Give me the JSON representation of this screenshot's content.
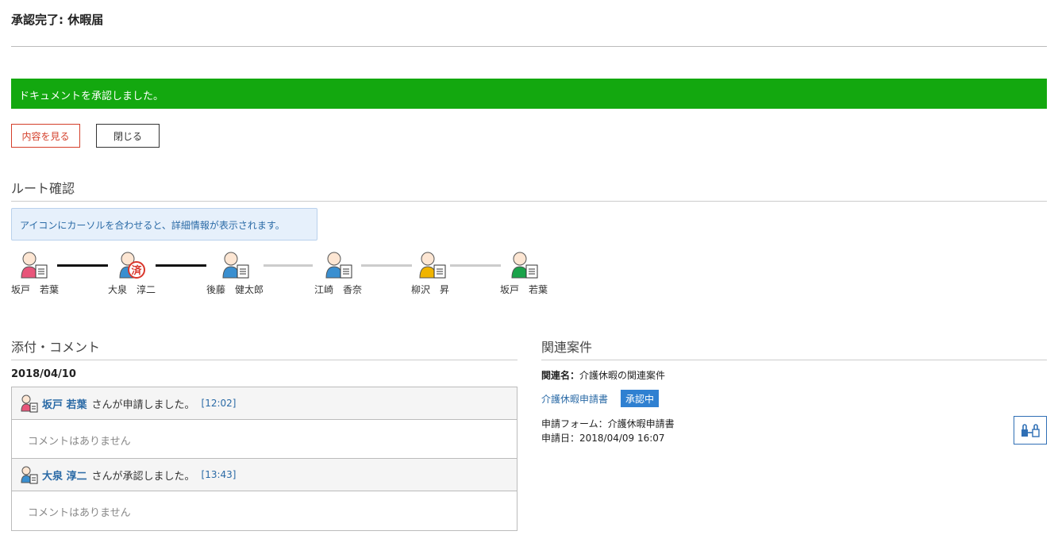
{
  "page": {
    "title": "承認完了: 休暇届"
  },
  "banner": {
    "message": "ドキュメントを承認しました。",
    "color": "#13a80f"
  },
  "actions": {
    "view_label": "内容を見る",
    "close_label": "閉じる"
  },
  "route": {
    "heading": "ルート確認",
    "hint": "アイコンにカーソルを合わせると、詳細情報が表示されます。",
    "nodes": [
      {
        "name": "坂戸　若葉",
        "color": "#e8557a",
        "icon": "applicant-icon"
      },
      {
        "name": "大泉　淳二",
        "color": "#3a8fd0",
        "icon": "approved-stamp-icon",
        "stamp": "済"
      },
      {
        "name": "後藤　健太郎",
        "color": "#3a8fd0",
        "icon": "approver-icon"
      },
      {
        "name": "江崎　香奈",
        "color": "#3a8fd0",
        "icon": "approver-icon"
      },
      {
        "name": "柳沢　昇",
        "color": "#f0b400",
        "icon": "approver-icon"
      },
      {
        "name": "坂戸　若葉",
        "color": "#1aa34a",
        "icon": "approver-icon"
      }
    ]
  },
  "comments": {
    "heading": "添付・コメント",
    "date": "2018/04/10",
    "entries": [
      {
        "user": "坂戸 若葉",
        "action": "さんが申請しました。",
        "time": "[12:02]",
        "comment": "コメントはありません"
      },
      {
        "user": "大泉 淳二",
        "action": "さんが承認しました。",
        "time": "[13:43]",
        "comment": "コメントはありません"
      }
    ]
  },
  "related": {
    "heading": "関連案件",
    "name_label": "関連名：",
    "name_value": "介護休暇の関連案件",
    "link": "介護休暇申請書",
    "status": "承認中",
    "form_line": "申請フォーム：介護休暇申請書",
    "date_line": "申請日：2018/04/09 16:07"
  }
}
